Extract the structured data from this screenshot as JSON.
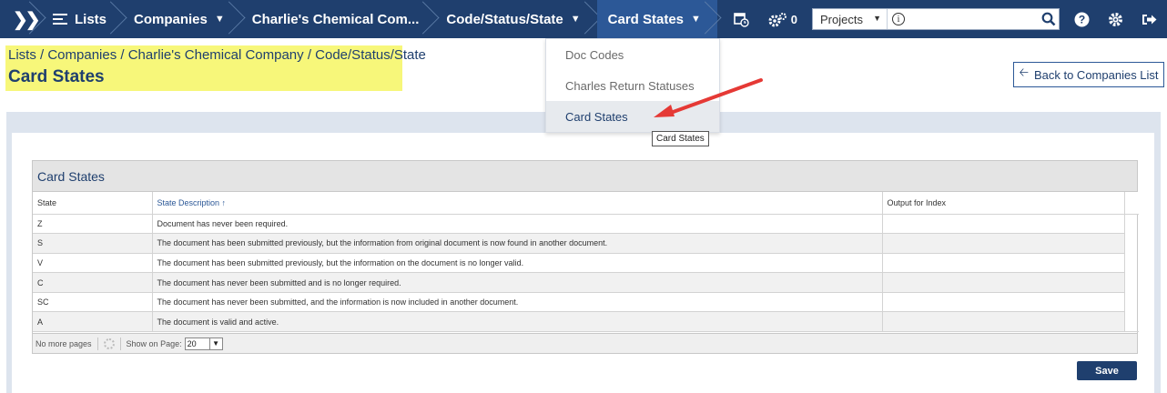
{
  "nav": {
    "logo_icon": "double-chevron-icon",
    "items": [
      {
        "label": "Lists",
        "icon": "list-icon"
      },
      {
        "label": "Companies",
        "caret": "⌄"
      },
      {
        "label": "Charlie's Chemical Com..."
      },
      {
        "label": "Code/Status/State",
        "caret": "⌄"
      },
      {
        "label": "Card States",
        "caret": "⌄"
      }
    ],
    "task_count": "0",
    "project_select": "Projects",
    "project_placeholder": ""
  },
  "breadcrumb": "Lists / Companies / Charlie's Chemical Company / Code/Status/State",
  "page_title": "Card States",
  "back_button": "Back to Companies List",
  "dropdown": {
    "items": [
      "Doc Codes",
      "Charles Return Statuses",
      "Card States"
    ],
    "tooltip": "Card States"
  },
  "grid": {
    "caption": "Card States",
    "columns": [
      "State",
      "State Description ↑",
      "Output for Index"
    ],
    "rows": [
      {
        "state": "Z",
        "description": "Document has never been required.",
        "output": ""
      },
      {
        "state": "S",
        "description": "The document has been submitted previously, but the information from original document is now found in another document.",
        "output": ""
      },
      {
        "state": "V",
        "description": "The document has been submitted previously, but the information on the document is no longer valid.",
        "output": ""
      },
      {
        "state": "C",
        "description": "The document has never been submitted and is no longer required.",
        "output": ""
      },
      {
        "state": "SC",
        "description": "The document has never been submitted, and the information is now included in another document.",
        "output": ""
      },
      {
        "state": "A",
        "description": "The document is valid and active.",
        "output": ""
      }
    ],
    "footer": {
      "no_more_pages": "No more pages",
      "show_on_page": "Show on Page:",
      "page_size": "20"
    }
  },
  "save_button": "Save",
  "colors": {
    "nav_bg": "#1f3f6e",
    "accent": "#2c5897",
    "highlight": "#f7f77a",
    "annotation_arrow": "#e53935"
  }
}
